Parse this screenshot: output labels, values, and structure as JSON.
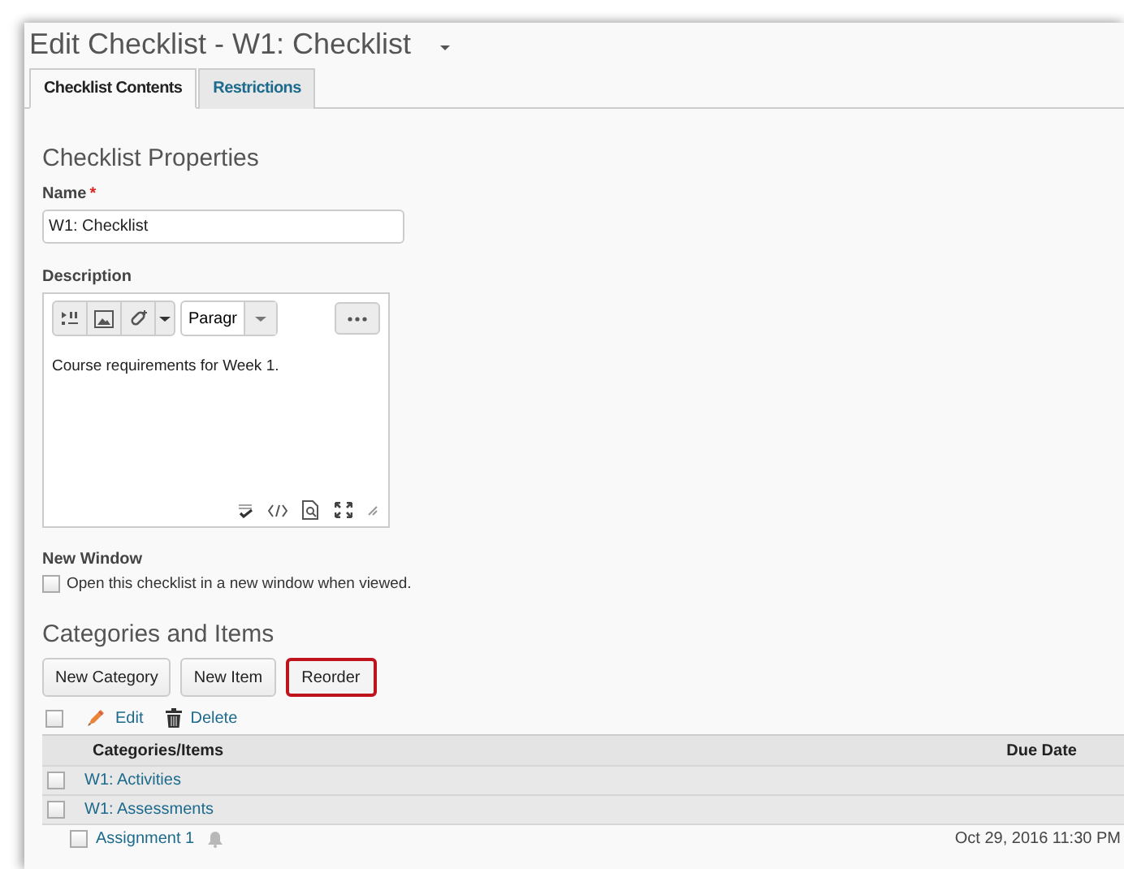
{
  "window": {
    "title": "Edit Checklist - W1: Checklist"
  },
  "tabs": [
    {
      "label": "Checklist Contents",
      "selected": true
    },
    {
      "label": "Restrictions",
      "selected": false
    }
  ],
  "properties": {
    "heading": "Checklist Properties",
    "name_label": "Name",
    "required_mark": "*",
    "name_value": "W1: Checklist",
    "description_label": "Description",
    "format": "Paragr",
    "description_text": "Course requirements for Week 1.",
    "new_window_label": "New Window",
    "new_window_option": {
      "label": "Open this checklist in a new window when viewed.",
      "checked": false
    }
  },
  "categories_section": {
    "heading": "Categories and Items",
    "buttons": [
      {
        "label": "New Category",
        "highlighted": false
      },
      {
        "label": "New Item",
        "highlighted": false
      },
      {
        "label": "Reorder",
        "highlighted": true
      }
    ],
    "select_all_checked": false,
    "actions": [
      {
        "kind": "edit",
        "label": "Edit"
      },
      {
        "kind": "delete",
        "label": "Delete"
      }
    ],
    "table": {
      "columns": [
        "Categories/Items",
        "Due Date"
      ],
      "rows": [
        {
          "name": "W1: Activities",
          "checked": false,
          "children": []
        },
        {
          "name": "W1: Assessments",
          "checked": false,
          "children": [
            {
              "name": "Assignment 1",
              "checked": false,
              "due": "Oct 29, 2016 11:30 PM"
            }
          ]
        }
      ]
    }
  }
}
